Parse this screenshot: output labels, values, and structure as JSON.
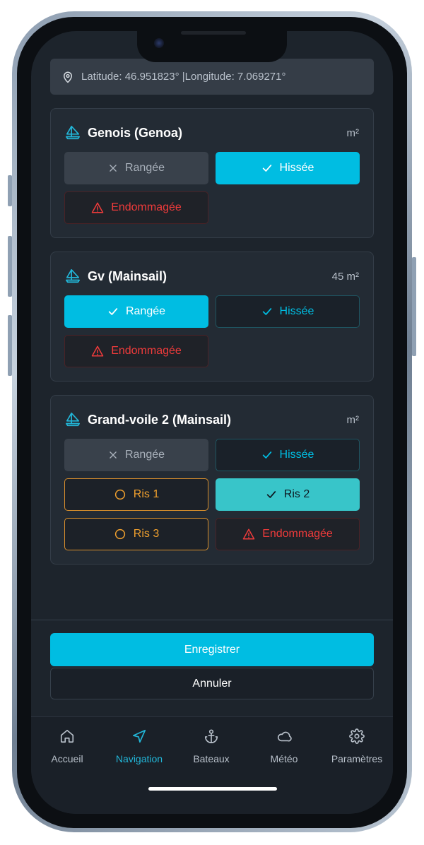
{
  "location": {
    "text": "Latitude: 46.951823° |Longitude: 7.069271°"
  },
  "sails": [
    {
      "name": "Genois (Genoa)",
      "area": "m²",
      "furled_label": "Rangée",
      "hoisted_label": "Hissée",
      "damaged_label": "Endommagée"
    },
    {
      "name": "Gv (Mainsail)",
      "area": "45 m²",
      "furled_label": "Rangée",
      "hoisted_label": "Hissée",
      "damaged_label": "Endommagée"
    },
    {
      "name": "Grand-voile 2 (Mainsail)",
      "area": "m²",
      "furled_label": "Rangée",
      "hoisted_label": "Hissée",
      "reef1_label": "Ris 1",
      "reef2_label": "Ris 2",
      "reef3_label": "Ris 3",
      "damaged_label": "Endommagée"
    }
  ],
  "actions": {
    "save": "Enregistrer",
    "cancel": "Annuler"
  },
  "tabs": [
    {
      "label": "Accueil",
      "icon": "home-icon"
    },
    {
      "label": "Navigation",
      "icon": "navigation-icon"
    },
    {
      "label": "Bateaux",
      "icon": "anchor-icon"
    },
    {
      "label": "Météo",
      "icon": "cloud-icon"
    },
    {
      "label": "Paramètres",
      "icon": "gear-icon"
    }
  ],
  "active_tab": "Navigation",
  "colors": {
    "accent": "#00bde2",
    "danger": "#ef3b3b",
    "reef": "#f0a02e",
    "reef_active": "#38c5c9",
    "background": "#1d242c"
  }
}
